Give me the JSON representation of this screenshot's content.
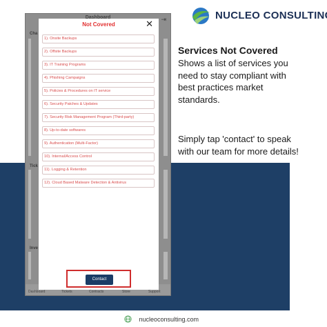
{
  "brand": {
    "name": "NUCLEO CONSULTING",
    "colors": {
      "navy": "#1e3f66",
      "accent_green": "#5bb544",
      "accent_blue": "#2b78c5"
    }
  },
  "panel": {
    "heading": "Services Not Covered",
    "description": "Shows a list of services you need to stay compliant with best practices market standards.",
    "cta_text": "Simply tap 'contact' to speak with our team for more details!"
  },
  "footer": {
    "url": "nucleoconsulting.com"
  },
  "phone": {
    "background": {
      "title": "Dashboard",
      "sections": [
        "Cha",
        "Tick",
        "Inve"
      ],
      "nav": [
        "Dashboard",
        "Tickets",
        "Contracts",
        "Store",
        "Support"
      ]
    },
    "modal": {
      "title": "Not Covered",
      "items": [
        "1). Onsite Backups",
        "2). Offsite Backups",
        "3). IT Training Programs",
        "4). Phishing Campaigns",
        "5). Policies & Procedures on  IT service",
        "6). Security Patches & Updates",
        "7). Security Risk Management Program (Third-party)",
        "8). Up-to-date softwares",
        "9). Authentication (Multi-Factor)",
        "10). Internal/Access Control",
        "11). Logging & Retention",
        "12). Cloud Based Malware Detection & Antivirus"
      ],
      "contact_label": "Contact"
    }
  }
}
